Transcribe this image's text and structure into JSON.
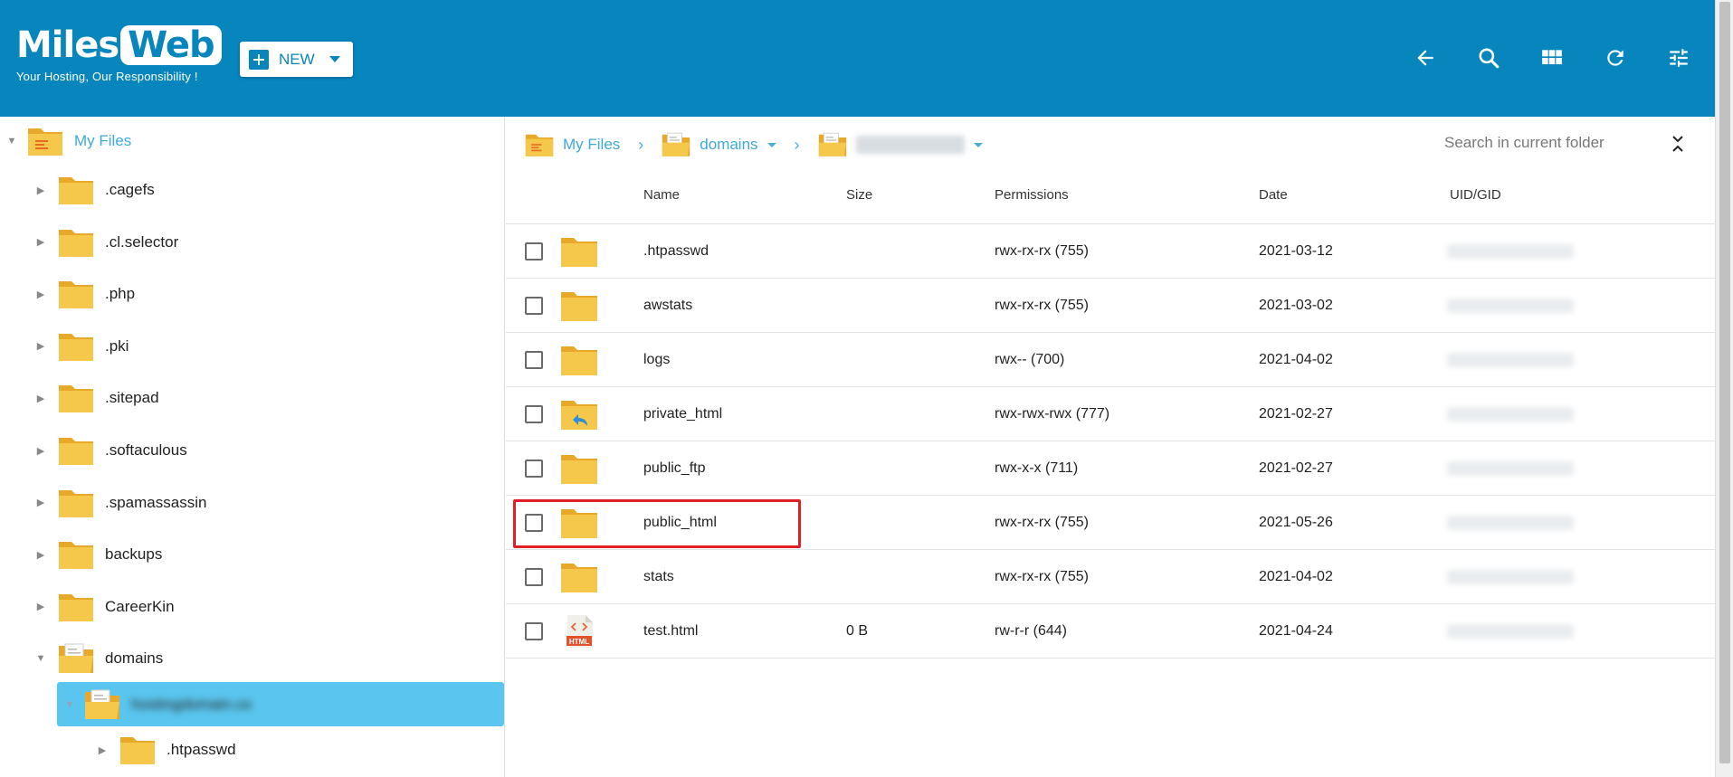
{
  "header": {
    "logo": {
      "miles": "Miles",
      "web": "Web",
      "tagline": "Your Hosting, Our Responsibility !"
    },
    "new_button": {
      "label": "NEW"
    },
    "tools": [
      {
        "name": "back-arrow-icon"
      },
      {
        "name": "search-icon"
      },
      {
        "name": "grid-view-icon"
      },
      {
        "name": "refresh-icon"
      },
      {
        "name": "settings-sliders-icon"
      }
    ],
    "color": "#0785bd"
  },
  "tree": {
    "root": {
      "label": "My Files"
    },
    "items": [
      {
        "label": ".cagefs"
      },
      {
        "label": ".cl.selector"
      },
      {
        "label": ".php"
      },
      {
        "label": ".pki"
      },
      {
        "label": ".sitepad"
      },
      {
        "label": ".softaculous"
      },
      {
        "label": ".spamassassin"
      },
      {
        "label": "backups"
      },
      {
        "label": "CareerKin"
      },
      {
        "label": "domains"
      }
    ],
    "selected_label": "hostingdomain.co",
    "child_label": ".htpasswd",
    "selected_color": "#5ac6ef"
  },
  "breadcrumb": {
    "root": "My Files",
    "level1": "domains"
  },
  "search": {
    "placeholder": "Search in current folder"
  },
  "table": {
    "columns": {
      "name": "Name",
      "size": "Size",
      "permissions": "Permissions",
      "date": "Date",
      "uid": "UID/GID"
    },
    "rows": [
      {
        "name": ".htpasswd",
        "size": "",
        "permissions": "rwx-rx-rx (755)",
        "date": "2021-03-12",
        "type": "folder"
      },
      {
        "name": "awstats",
        "size": "",
        "permissions": "rwx-rx-rx (755)",
        "date": "2021-03-02",
        "type": "folder"
      },
      {
        "name": "logs",
        "size": "",
        "permissions": "rwx-- (700)",
        "date": "2021-04-02",
        "type": "folder"
      },
      {
        "name": "private_html",
        "size": "",
        "permissions": "rwx-rwx-rwx (777)",
        "date": "2021-02-27",
        "type": "folder-link"
      },
      {
        "name": "public_ftp",
        "size": "",
        "permissions": "rwx-x-x (711)",
        "date": "2021-02-27",
        "type": "folder"
      },
      {
        "name": "public_html",
        "size": "",
        "permissions": "rwx-rx-rx (755)",
        "date": "2021-05-26",
        "type": "folder"
      },
      {
        "name": "stats",
        "size": "",
        "permissions": "rwx-rx-rx (755)",
        "date": "2021-04-02",
        "type": "folder"
      },
      {
        "name": "test.html",
        "size": "0 B",
        "permissions": "rw-r-r (644)",
        "date": "2021-04-24",
        "type": "html-file"
      }
    ],
    "html_badge": "HTML",
    "highlight_color": "#e01f26"
  }
}
